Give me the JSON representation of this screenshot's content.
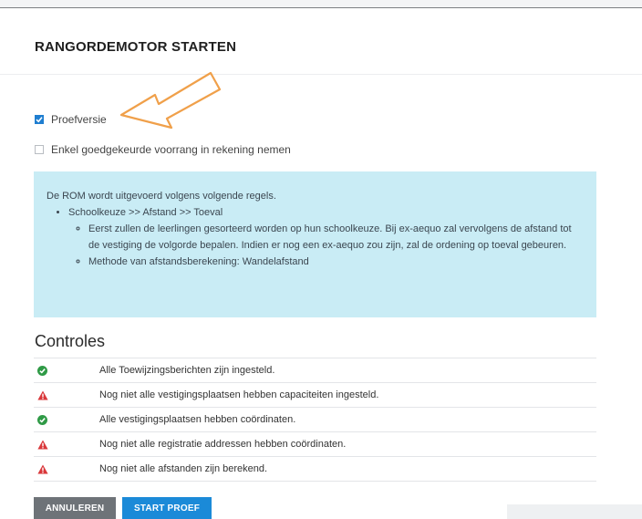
{
  "page": {
    "title": "RANGORDEMOTOR STARTEN"
  },
  "options": [
    {
      "label": "Proefversie",
      "checked": true
    },
    {
      "label": "Enkel goedgekeurde voorrang in rekening nemen",
      "checked": false
    }
  ],
  "info": {
    "intro": "De ROM wordt uitgevoerd volgens volgende regels.",
    "rule": "Schoolkeuze >> Afstand >> Toeval",
    "details": [
      "Eerst zullen de leerlingen gesorteerd worden op hun schoolkeuze. Bij ex-aequo zal vervolgens de afstand tot de vestiging de volgorde bepalen. Indien er nog een ex-aequo zou zijn, zal de ordening op toeval gebeuren.",
      "Methode van afstandsberekening: Wandelafstand"
    ]
  },
  "controles": {
    "title": "Controles",
    "items": [
      {
        "status": "ok",
        "icon": "check-circle-icon",
        "text": "Alle Toewijzingsberichten zijn ingesteld."
      },
      {
        "status": "warning",
        "icon": "warning-triangle-icon",
        "text": "Nog niet alle vestigingsplaatsen hebben capaciteiten ingesteld."
      },
      {
        "status": "ok",
        "icon": "check-circle-icon",
        "text": "Alle vestigingsplaatsen hebben coördinaten."
      },
      {
        "status": "warning",
        "icon": "warning-triangle-icon",
        "text": "Nog niet alle registratie addressen hebben coördinaten."
      },
      {
        "status": "warning",
        "icon": "warning-triangle-icon",
        "text": "Nog niet alle afstanden zijn berekend."
      }
    ]
  },
  "buttons": {
    "cancel": "ANNULEREN",
    "start": "START PROEF"
  },
  "colors": {
    "primary": "#1b8ad8",
    "secondary": "#6e7378",
    "info_bg": "#c9ecf5",
    "ok": "#2f9a46",
    "warning": "#d9373a",
    "annotation_arrow": "#f0a04a"
  }
}
